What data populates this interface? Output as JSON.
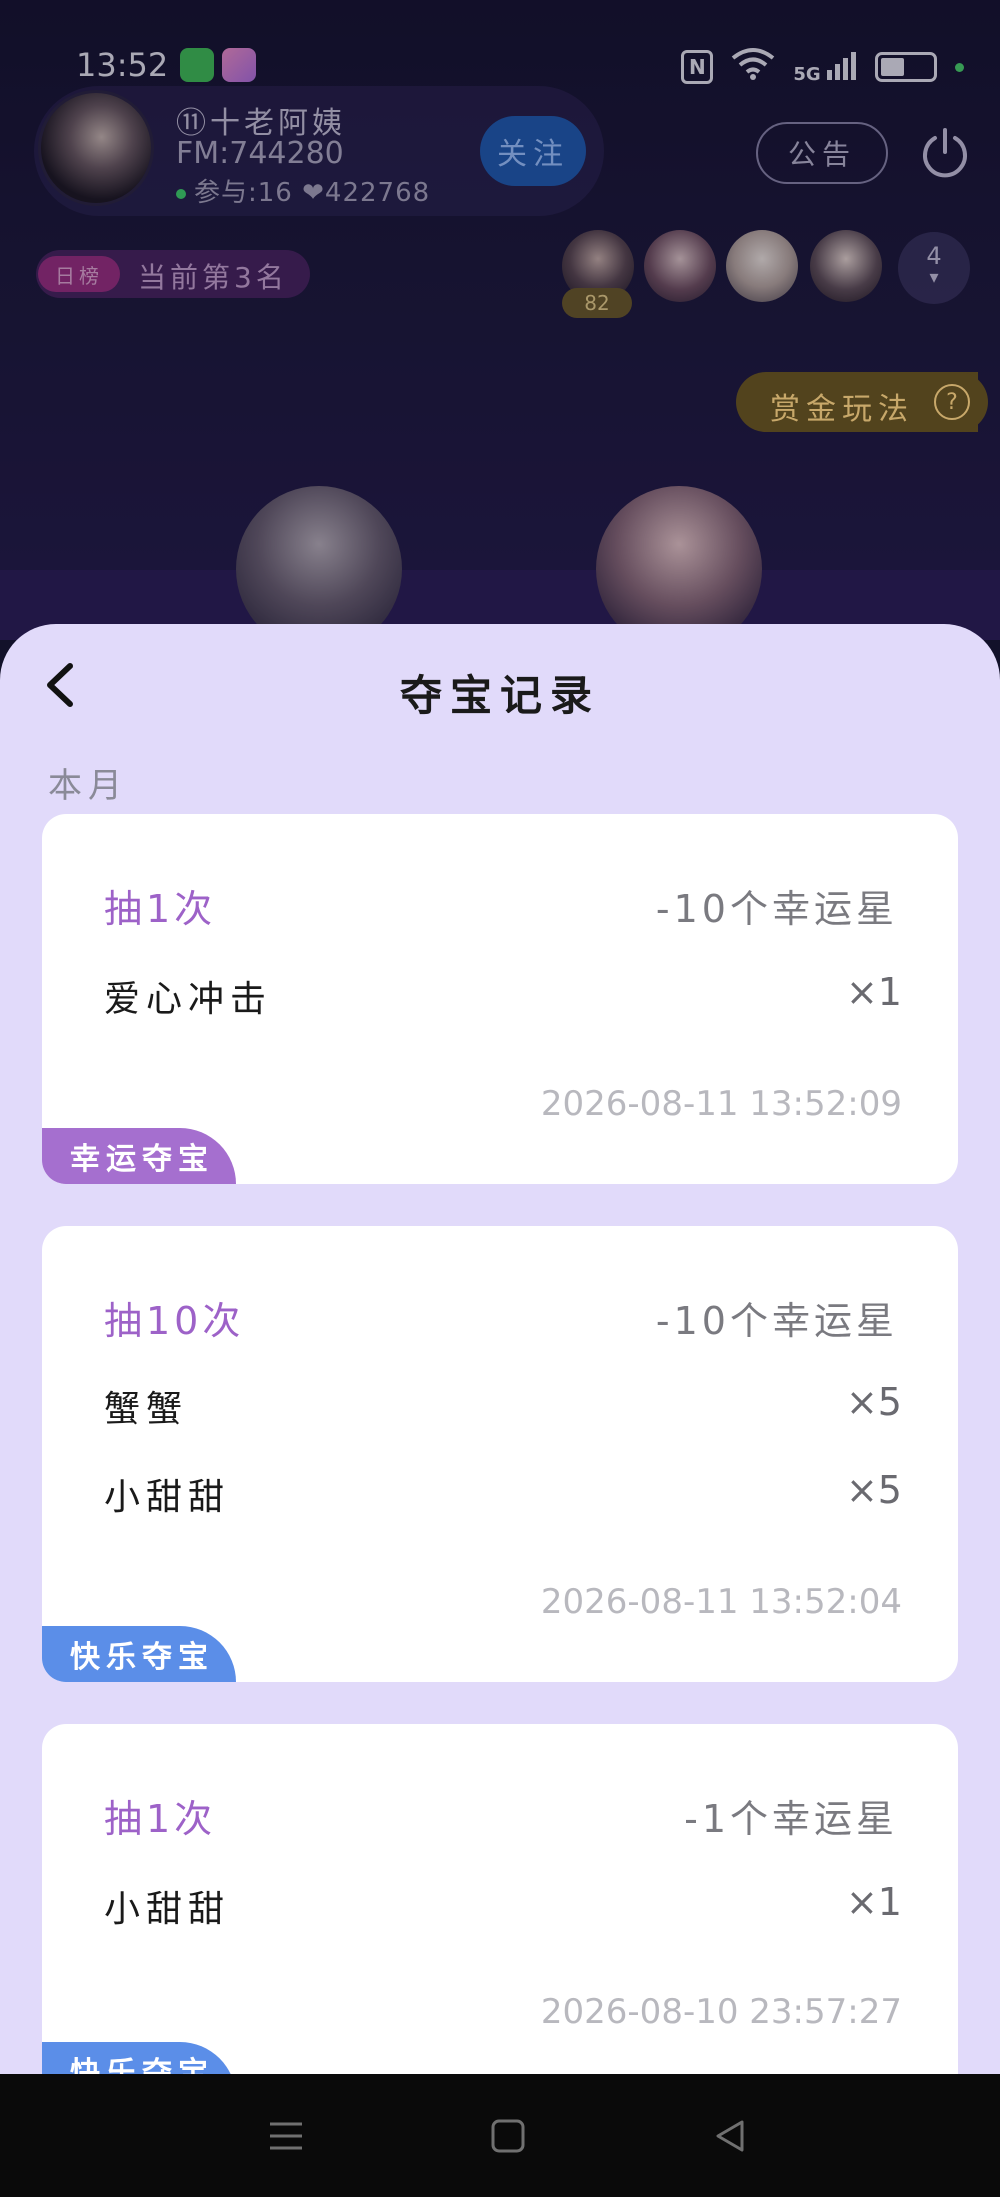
{
  "status_bar": {
    "time": "13:52",
    "network": "5G",
    "battery_level": 0.45,
    "icons": [
      "wechat-icon",
      "app-icon",
      "nfc-icon",
      "wifi-icon",
      "signal-icon",
      "battery-icon"
    ]
  },
  "room": {
    "host_name": "⑪十老阿姨",
    "fm_id": "FM:744280",
    "participants": "参与:16",
    "hearts": "422768",
    "follow_label": "关注",
    "notice_label": "公告",
    "rank_tag": "日榜",
    "rank_text": "当前第3名",
    "audience_badge": "82",
    "audience_count": "4",
    "bounty_label": "赏金玩法",
    "help_label": "?"
  },
  "sheet": {
    "title": "夺宝记录",
    "section": "本月"
  },
  "records": [
    {
      "draw": "抽1次",
      "cost": "-10个幸运星",
      "items": [
        {
          "name": "爱心冲击",
          "qty": "×1"
        }
      ],
      "time": "2026-08-11 13:52:09",
      "tag": "幸运夺宝",
      "tag_color": "#a56fcf"
    },
    {
      "draw": "抽10次",
      "cost": "-10个幸运星",
      "items": [
        {
          "name": "蟹蟹",
          "qty": "×5"
        },
        {
          "name": "小甜甜",
          "qty": "×5"
        }
      ],
      "time": "2026-08-11 13:52:04",
      "tag": "快乐夺宝",
      "tag_color": "#5b8ee8"
    },
    {
      "draw": "抽1次",
      "cost": "-1个幸运星",
      "items": [
        {
          "name": "小甜甜",
          "qty": "×1"
        }
      ],
      "time": "2026-08-10 23:57:27",
      "tag": "快乐夺宝",
      "tag_color": "#5b8ee8"
    }
  ],
  "colors": {
    "sheet_bg": "#e1dafa",
    "draw_text": "#9d62c8",
    "lucky_tag": "#a56fcf",
    "happy_tag": "#5b8ee8"
  }
}
